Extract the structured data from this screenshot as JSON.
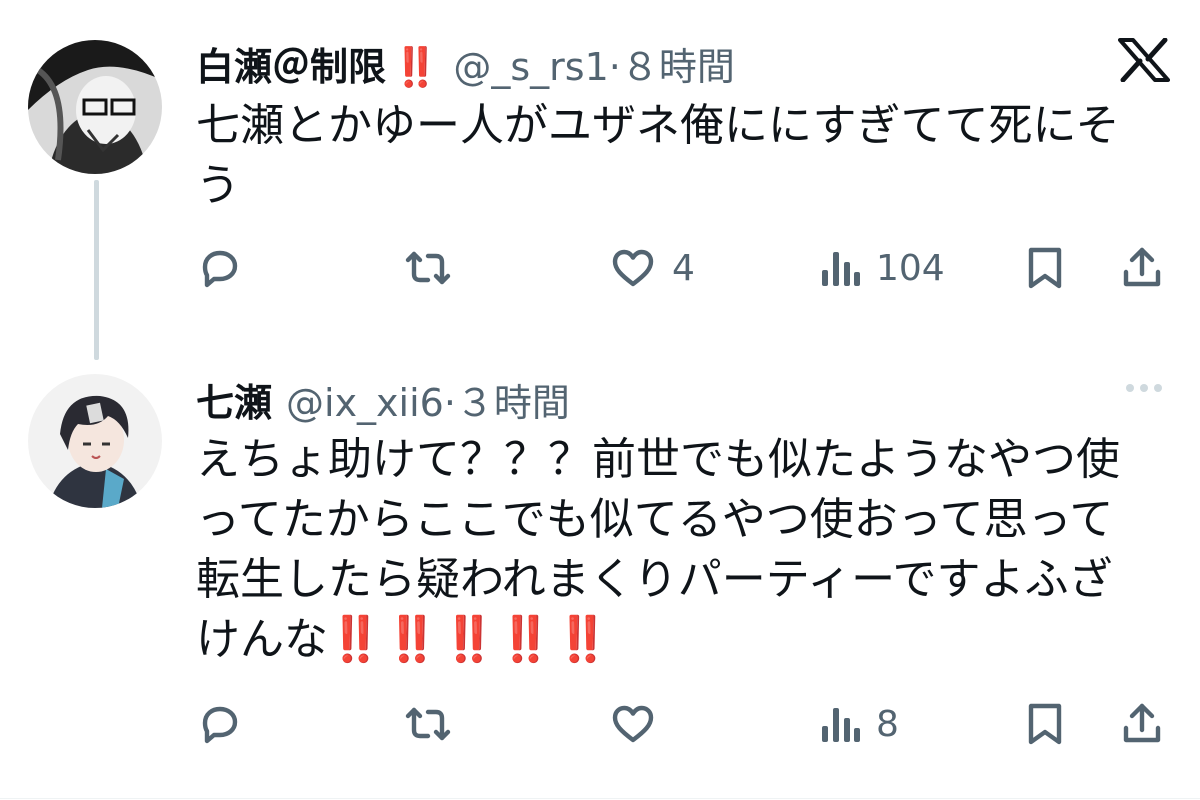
{
  "tweets": [
    {
      "name": "白瀬＠制限",
      "name_emoji": "‼️",
      "handle": "@_s_rs1",
      "time": "·８時間",
      "text": "七瀬とかゆー人がユザネ俺ににすぎてて死にそう",
      "actions": {
        "reply": "",
        "retweet": "",
        "like": "4",
        "views": "104"
      }
    },
    {
      "name": "七瀬",
      "handle": "@ix_xii6",
      "time": "·３時間",
      "text": "えちょ助けて？？？前世でも似たようなやつ使ってたからここでも似てるやつ使おって思って転生したら疑われまくりパーティーですよふざけんな",
      "text_emoji": "‼️‼️‼️‼️‼️",
      "actions": {
        "reply": "",
        "retweet": "",
        "like": "",
        "views": "8"
      }
    }
  ],
  "icons": {
    "x_logo": "x-logo-icon",
    "reply": "reply-icon",
    "retweet": "retweet-icon",
    "like": "heart-icon",
    "views": "views-icon",
    "bookmark": "bookmark-icon",
    "share": "share-icon",
    "more": "more-icon"
  },
  "colors": {
    "text": "#0f1419",
    "secondary": "#536471",
    "emoji_red": "#e0245e",
    "thread_line": "#cfd9de"
  }
}
